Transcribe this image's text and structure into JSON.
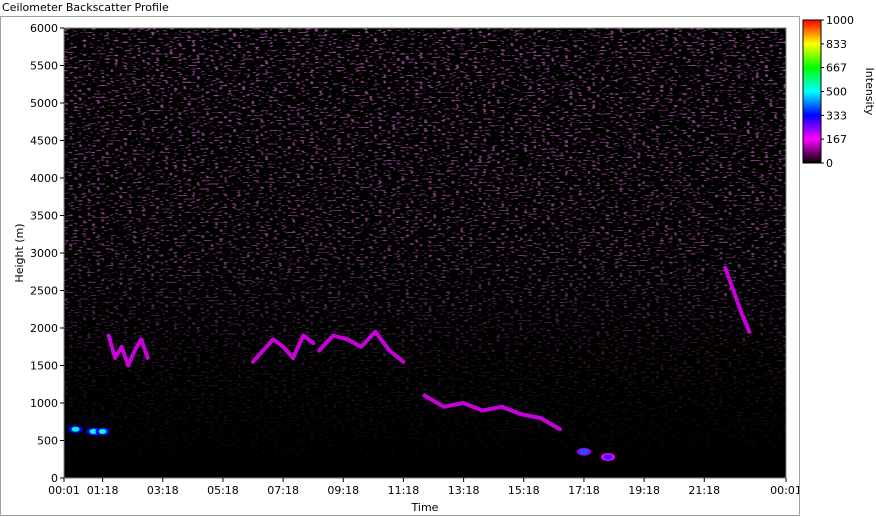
{
  "window": {
    "title": "Ceilometer Backscatter Profile"
  },
  "chart_data": {
    "type": "heatmap",
    "title": "",
    "xlabel": "Time",
    "ylabel": "Height (m)",
    "x_ticks": [
      "00:01",
      "01:18",
      "03:18",
      "05:18",
      "07:18",
      "09:18",
      "11:18",
      "13:18",
      "15:18",
      "17:18",
      "19:18",
      "21:18",
      "00:01"
    ],
    "x_tick_hours": [
      0.0167,
      1.3,
      3.3,
      5.3,
      7.3,
      9.3,
      11.3,
      13.3,
      15.3,
      17.3,
      19.3,
      21.3,
      24.0167
    ],
    "x_range_hours": [
      0.0167,
      24.0167
    ],
    "y_ticks": [
      0,
      500,
      1000,
      1500,
      2000,
      2500,
      3000,
      3500,
      4000,
      4500,
      5000,
      5500,
      6000
    ],
    "ylim": [
      0,
      6000
    ],
    "colorbar": {
      "label": "Intensity",
      "ticks": [
        1000,
        833,
        667,
        500,
        333,
        167,
        0
      ],
      "range": [
        0,
        1000
      ],
      "stops": [
        "#000000",
        "#ff00ff",
        "#0000ff",
        "#00ffff",
        "#00ff00",
        "#ffff00",
        "#ff0000"
      ]
    },
    "background": "#000000",
    "noise_color": "#ff33ff",
    "grid": false,
    "cloud_layers": [
      {
        "start_hour": 1.5,
        "end_hour": 2.8,
        "height_m": [
          1900,
          1600,
          1750,
          1500,
          1700,
          1850,
          1600
        ]
      },
      {
        "start_hour": 6.3,
        "end_hour": 8.3,
        "height_m": [
          1550,
          1700,
          1850,
          1750,
          1600,
          1900,
          1800
        ]
      },
      {
        "start_hour": 8.5,
        "end_hour": 11.3,
        "height_m": [
          1700,
          1900,
          1850,
          1750,
          1950,
          1700,
          1550
        ]
      },
      {
        "start_hour": 12.0,
        "end_hour": 16.5,
        "height_m": [
          1100,
          950,
          1000,
          900,
          950,
          850,
          800,
          650
        ]
      },
      {
        "start_hour": 22.0,
        "end_hour": 22.8,
        "height_m": [
          2800,
          2500,
          2200,
          1950
        ]
      }
    ],
    "intense_spots": [
      {
        "hour": 0.4,
        "height_m": 650,
        "value": 550
      },
      {
        "hour": 1.0,
        "height_m": 620,
        "value": 520
      },
      {
        "hour": 1.3,
        "height_m": 620,
        "value": 550
      },
      {
        "hour": 17.3,
        "height_m": 350,
        "value": 400
      },
      {
        "hour": 18.1,
        "height_m": 280,
        "value": 300
      }
    ]
  }
}
